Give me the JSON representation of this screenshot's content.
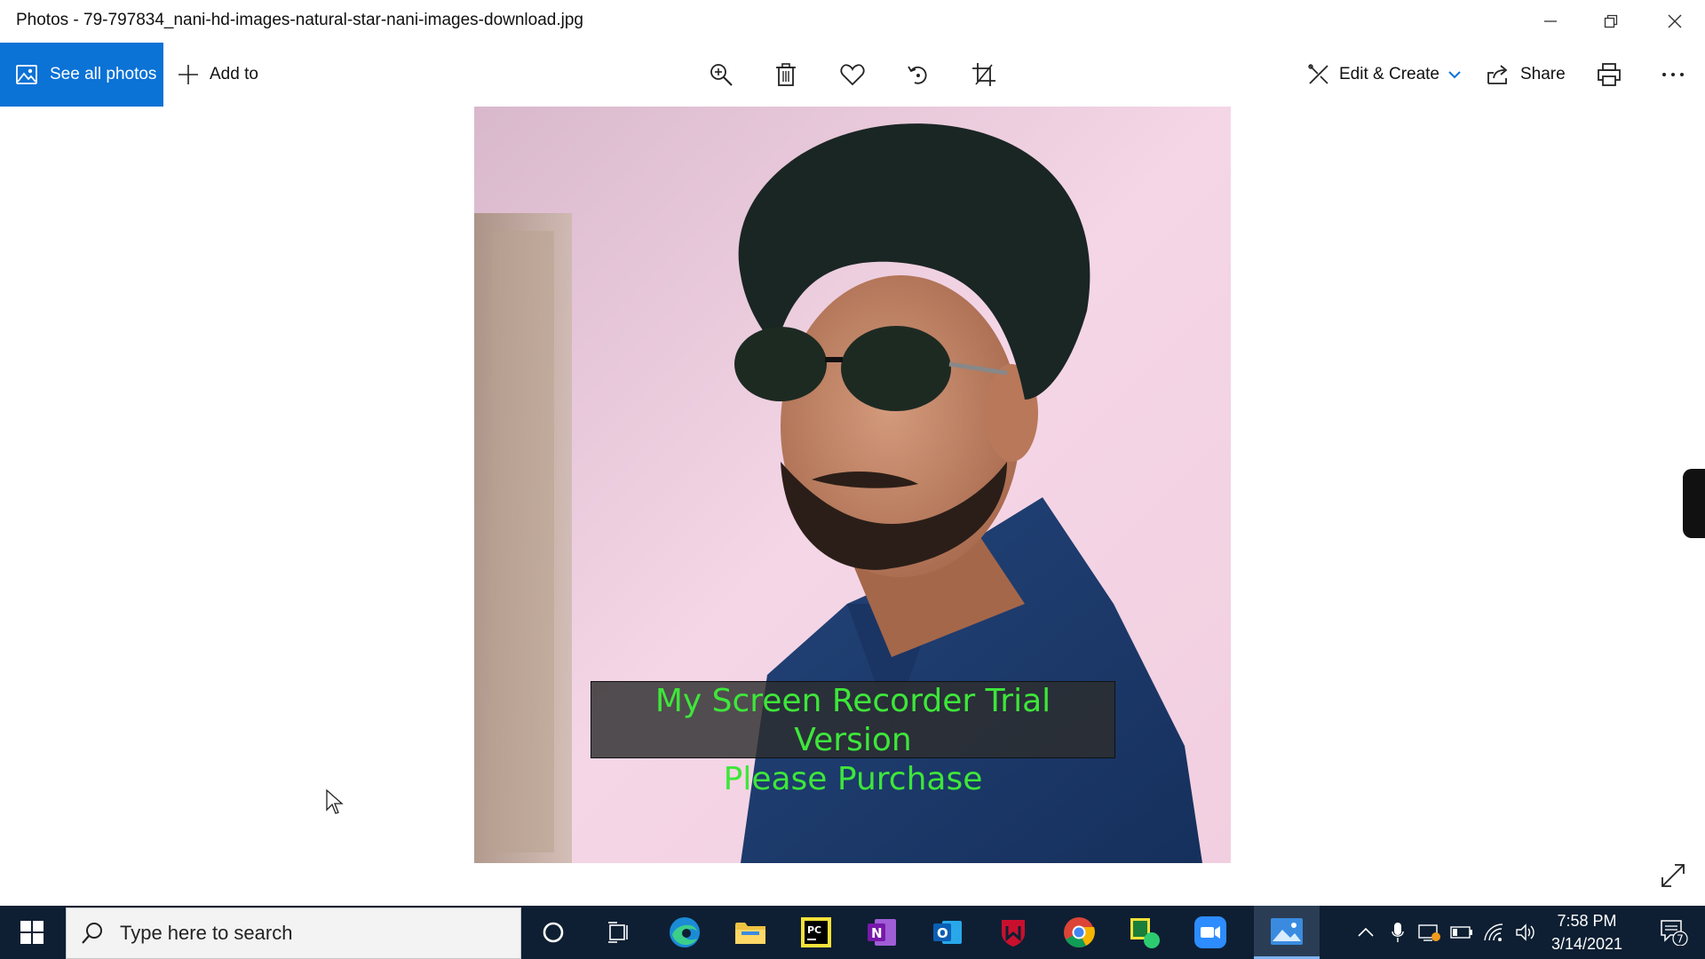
{
  "window": {
    "title": "Photos - 79-797834_nani-hd-images-natural-star-nani-images-download.jpg"
  },
  "toolbar": {
    "see_all_label": "See all photos",
    "add_to_label": "Add to",
    "edit_create_label": "Edit & Create",
    "share_label": "Share"
  },
  "photo": {
    "watermark_line1": "My Screen Recorder Trial Version",
    "watermark_line2": "Please Purchase"
  },
  "taskbar": {
    "search_placeholder": "Type here to search",
    "apps": [
      "cortana",
      "task-view",
      "edge",
      "file-explorer",
      "pycharm",
      "onenote",
      "outlook",
      "mcafee",
      "chrome",
      "app-green",
      "zoom",
      "photos"
    ],
    "clock_time": "7:58 PM",
    "clock_date": "3/14/2021",
    "notification_count": "7"
  },
  "colors": {
    "accent": "#0b72d6",
    "taskbar": "#0e1f33",
    "watermark_text": "#3ee63a"
  }
}
